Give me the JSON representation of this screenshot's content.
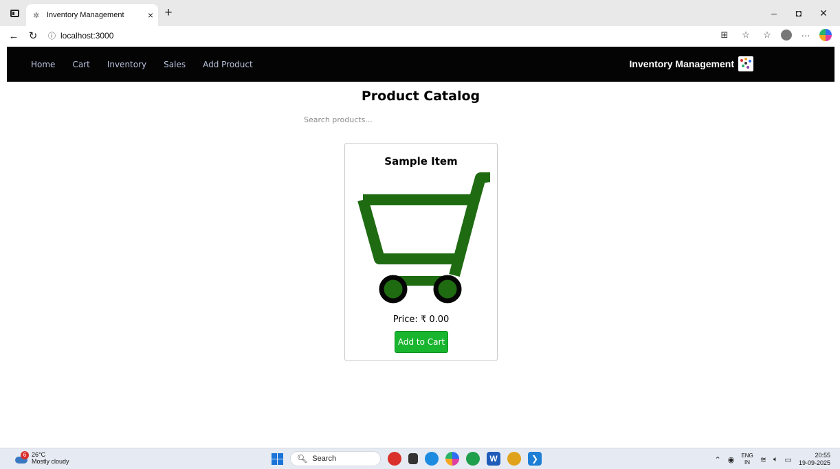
{
  "browser": {
    "tab_title": "Inventory Management",
    "tab_close": "×",
    "new_tab": "+",
    "url": "localhost:3000",
    "window_controls": {
      "minimize": "–",
      "restore": "◘",
      "close": "✕"
    }
  },
  "nav": {
    "links": [
      {
        "label": "Home"
      },
      {
        "label": "Cart"
      },
      {
        "label": "Inventory"
      },
      {
        "label": "Sales"
      },
      {
        "label": "Add Product"
      }
    ],
    "brand": "Inventory Management"
  },
  "page": {
    "title": "Product Catalog",
    "search_placeholder": "Search products..."
  },
  "products": [
    {
      "name": "Sample Item",
      "price_text": "Price: ₹ 0.00",
      "button_label": "Add to Cart",
      "image_icon": "shopping-cart-icon"
    }
  ],
  "taskbar": {
    "weather_badge": "6",
    "temperature": "26°C",
    "condition": "Mostly cloudy",
    "search_label": "Search",
    "language_line1": "ENG",
    "language_line2": "IN",
    "time": "20:55",
    "date": "19-09-2025"
  },
  "colors": {
    "nav_background": "#040404",
    "nav_link": "#b9c2dd",
    "cart_green": "#1f6b12",
    "button_green": "#19b52f"
  }
}
